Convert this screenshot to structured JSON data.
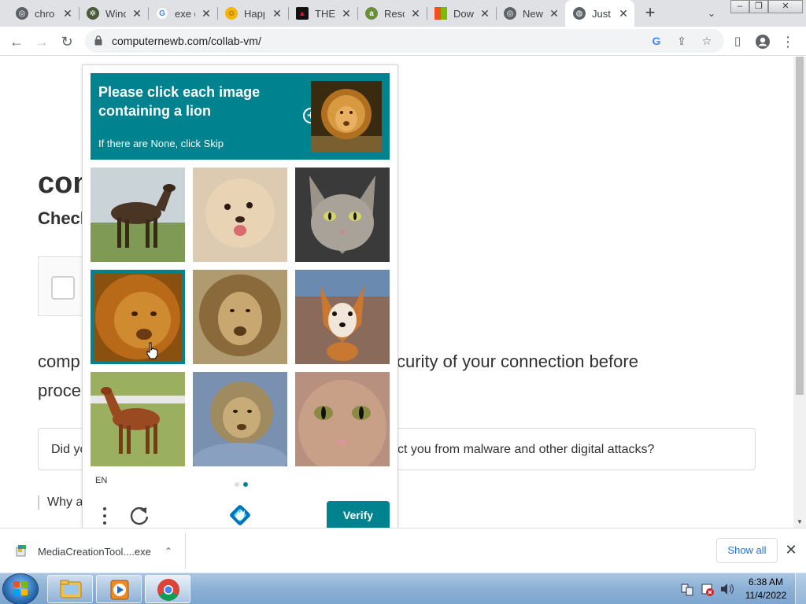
{
  "browser": {
    "tabs": [
      {
        "title": "chro"
      },
      {
        "title": "Winc"
      },
      {
        "title": "exe d"
      },
      {
        "title": "Happ"
      },
      {
        "title": "THE"
      },
      {
        "title": "Resc"
      },
      {
        "title": "Dow"
      },
      {
        "title": "New"
      },
      {
        "title": "Just"
      }
    ],
    "new_tab_label": "+",
    "tab_search_label": "⌄",
    "url": "computernewb.com/collab-vm/"
  },
  "page": {
    "heading": "con",
    "subheading": "Checl",
    "paragraph_line1_left": "comp",
    "paragraph_line1_right": "curity of your connection before",
    "paragraph_line2": "proce",
    "did_left": "Did yc",
    "did_right": "ct you from malware and other digital attacks?",
    "why": "Why a"
  },
  "captcha": {
    "title": "Please click each image containing a lion",
    "subtitle": "If there are None, click Skip",
    "plus": "+",
    "language": "EN",
    "verify_label": "Verify",
    "tiles": [
      {
        "content": "horse",
        "selected": false
      },
      {
        "content": "dog",
        "selected": false
      },
      {
        "content": "cat",
        "selected": false
      },
      {
        "content": "lion",
        "selected": true
      },
      {
        "content": "lion",
        "selected": false
      },
      {
        "content": "corgi",
        "selected": false
      },
      {
        "content": "horse",
        "selected": false
      },
      {
        "content": "lion",
        "selected": false
      },
      {
        "content": "cat",
        "selected": false
      }
    ],
    "accent_color": "#00838f"
  },
  "downloads": {
    "file_name": "MediaCreationTool....exe",
    "show_all_label": "Show all",
    "close_label": "✕"
  },
  "taskbar": {
    "time": "6:38 AM",
    "date": "11/4/2022"
  }
}
